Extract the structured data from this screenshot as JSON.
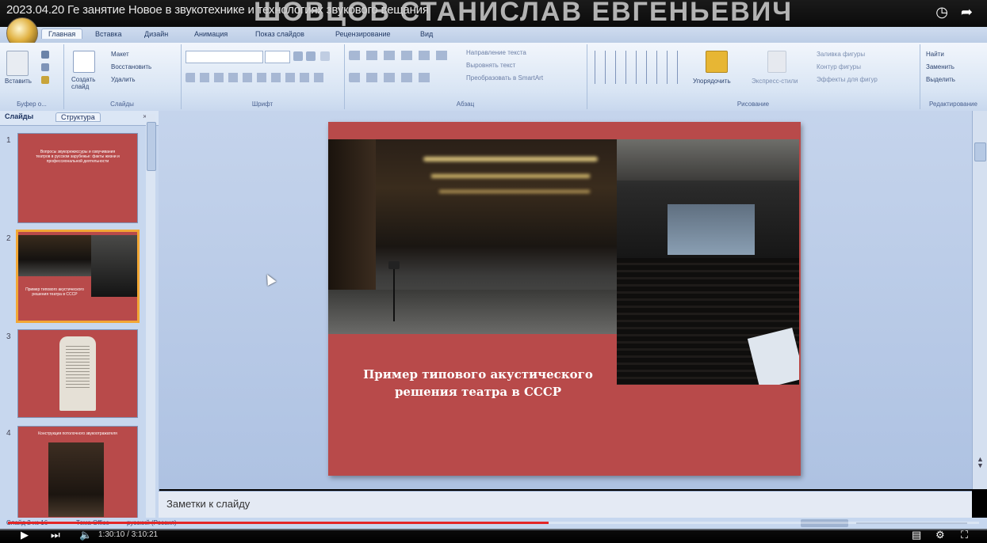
{
  "window": {
    "title_small": "2023.04.20 Ге занятие Новое в звукотехнике и технологиях звукового вещания",
    "title_large": "ШОВЦОВ СТАНИСЛАВ ЕВГЕНЬЕВИЧ",
    "icons": [
      "clock-icon",
      "share-icon"
    ]
  },
  "ribbon": {
    "tabs": [
      "Главная",
      "Вставка",
      "Дизайн",
      "Анимация",
      "Показ слайдов",
      "Рецензирование",
      "Вид"
    ],
    "active_tab": "Главная",
    "groups": {
      "clipboard": {
        "label": "Буфер о...",
        "paste": "Вставить"
      },
      "slides": {
        "label": "Слайды",
        "new_slide": "Создать слайд",
        "layout": "Макет",
        "reset": "Восстановить",
        "delete": "Удалить"
      },
      "font": {
        "label": "Шрифт"
      },
      "paragraph": {
        "label": "Абзац",
        "text_direction": "Направление текста",
        "align_text": "Выровнять текст",
        "convert_smartart": "Преобразовать в SmartArt"
      },
      "drawing": {
        "label": "Рисование",
        "arrange": "Упорядочить",
        "quick_styles": "Экспресс-стили",
        "shape_fill": "Заливка фигуры",
        "shape_outline": "Контур фигуры",
        "shape_effects": "Эффекты для фигур"
      },
      "editing": {
        "label": "Редактирование",
        "find": "Найти",
        "replace": "Заменить",
        "select": "Выделить"
      }
    }
  },
  "panel": {
    "tab_slides": "Слайды",
    "tab_outline": "Структура",
    "close": "×",
    "thumbs": [
      {
        "num": "1",
        "text": "Вопросы звукорежиссуры и озвучивания театров в русском зарубежье: факты жизни и профессиональной деятельности"
      },
      {
        "num": "2",
        "text": "Пример типового акустического решения театра в СССР"
      },
      {
        "num": "3",
        "text": ""
      },
      {
        "num": "4",
        "text": "Конструкция потолочного звукоотражателя"
      }
    ]
  },
  "slide": {
    "caption_line1": "Пример типового акустического",
    "caption_line2": "решения театра в СССР"
  },
  "notes": {
    "placeholder": "Заметки к слайду"
  },
  "status": {
    "slide_info": "Слайд 2 из 16",
    "theme": "Тема Office",
    "language": "русский (Россия)"
  },
  "video": {
    "time": "1:30:10 / 3:10:21",
    "progress": 0.557
  }
}
